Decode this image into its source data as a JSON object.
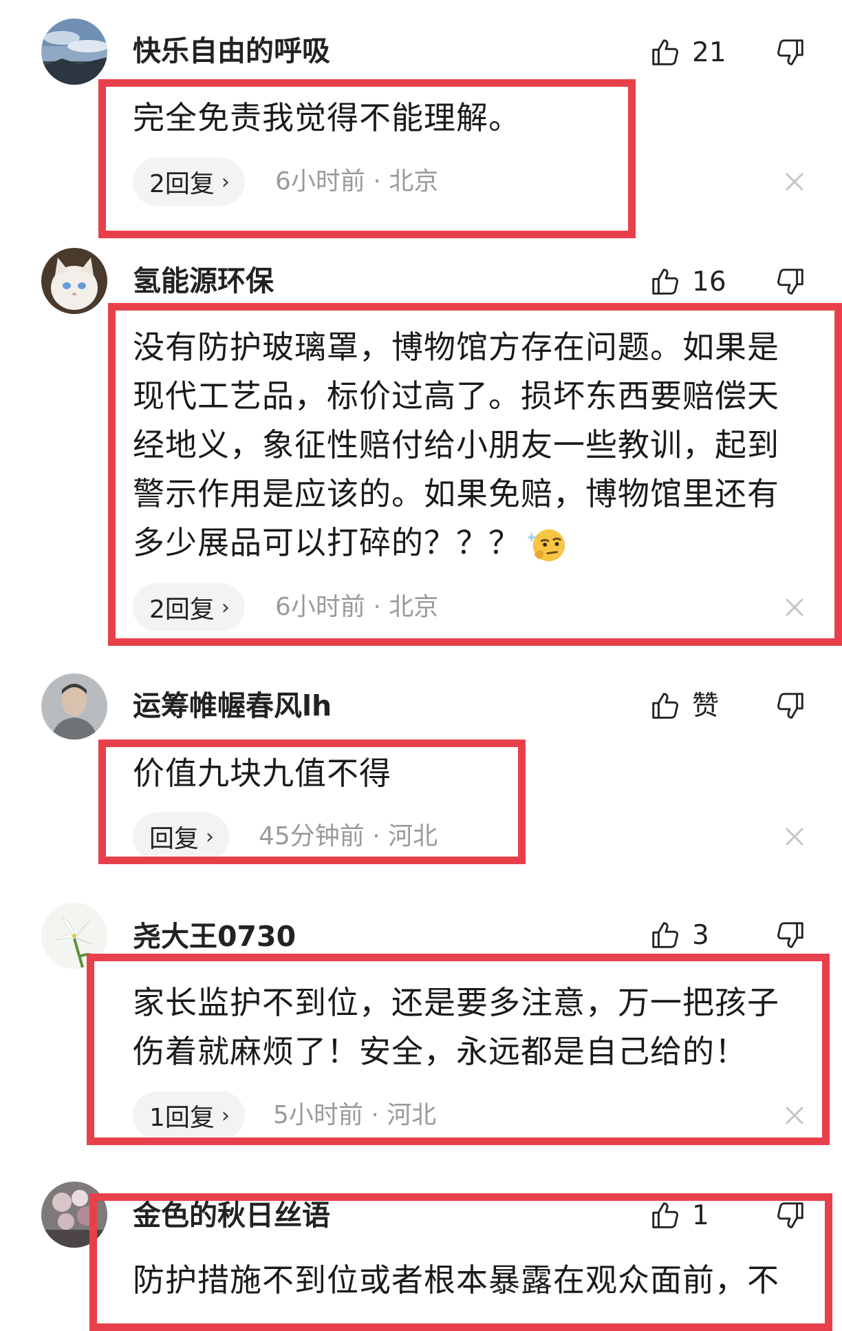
{
  "comments": [
    {
      "username": "快乐自由的呼吸",
      "likes": "21",
      "text": "完全免责我觉得不能理解。",
      "reply_label": "2回复",
      "meta": "6小时前 · 北京",
      "avatar_icon": "avatar-sky-icon"
    },
    {
      "username": "氢能源环保",
      "likes": "16",
      "text": "没有防护玻璃罩，博物馆方存在问题。如果是现代工艺品，标价过高了。损坏东西要赔偿天经地义，象征性赔付给小朋友一些教训，起到警示作用是应该的。如果免赔，博物馆里还有多少展品可以打碎的？？？",
      "emoji_icon": "thinking-face-emoji-icon",
      "reply_label": "2回复",
      "meta": "6小时前 · 北京",
      "avatar_icon": "avatar-cat-icon"
    },
    {
      "username": "运筹帷幄春风lh",
      "likes": "赞",
      "text": "价值九块九值不得",
      "reply_label": "回复",
      "meta": "45分钟前 · 河北",
      "avatar_icon": "avatar-person-icon"
    },
    {
      "username": "尧大王0730",
      "likes": "3",
      "text": "家长监护不到位，还是要多注意，万一把孩子伤着就麻烦了！安全，永远都是自己给的！",
      "reply_label": "1回复",
      "meta": "5小时前 · 河北",
      "avatar_icon": "avatar-lily-icon"
    },
    {
      "username": "金色的秋日丝语",
      "likes": "1",
      "text": "防护措施不到位或者根本暴露在观众面前，不",
      "avatar_icon": "avatar-flowers-icon"
    }
  ],
  "colors": {
    "highlight": "#e8404b",
    "meta_text": "#9a9a9a",
    "pill_bg": "#f3f3f3"
  }
}
